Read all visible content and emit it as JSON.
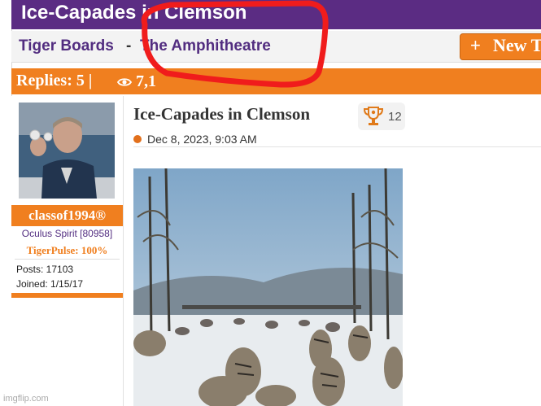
{
  "header": {
    "title": "Ice-Capades in Clemson"
  },
  "breadcrumb": {
    "board": "Tiger Boards",
    "separator": "-",
    "forum": "The Amphitheatre"
  },
  "toolbar": {
    "new_button_label": "New T",
    "new_button_plus": "+"
  },
  "thread_stats": {
    "replies": "Replies: 5 |",
    "views": "7,1"
  },
  "user": {
    "username": "classof1994®",
    "spirit": "Oculus Spirit [80958]",
    "pulse": "TigerPulse: 100%",
    "posts": "Posts: 17103",
    "joined": "Joined: 1/15/17"
  },
  "post": {
    "title": "Ice-Capades in Clemson",
    "trophy_count": "12",
    "timestamp": "Dec 8, 2023, 9:03 AM"
  },
  "watermark": "imgflip.com",
  "colors": {
    "purple": "#5b2c83",
    "orange": "#f07f1f",
    "red_annotation": "#f01c1c"
  },
  "icons": [
    "eye-icon",
    "trophy-icon",
    "plus-icon"
  ]
}
